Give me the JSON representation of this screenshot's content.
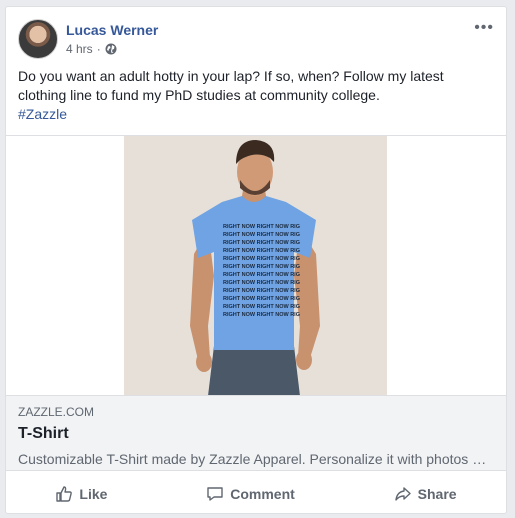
{
  "post": {
    "author": "Lucas Werner",
    "time": "4 hrs",
    "separator": "·",
    "more_icon": "more-horizontal-icon",
    "text": "Do you want an adult hotty in your lap? If so, when? Follow my latest clothing line to fund my PhD studies at community college.",
    "hashtag": "#Zazzle"
  },
  "shirt_print": "RIGHT NOW RIGHT NOW RIG",
  "link": {
    "domain": "ZAZZLE.COM",
    "title": "T-Shirt",
    "description": "Customizable T-Shirt made by Zazzle Apparel. Personalize it with photos & text or purchase as is!"
  },
  "actions": {
    "like": "Like",
    "comment": "Comment",
    "share": "Share"
  },
  "colors": {
    "link_blue": "#365899",
    "shirt_blue": "#6fa3e3",
    "gray_text": "#606770"
  }
}
